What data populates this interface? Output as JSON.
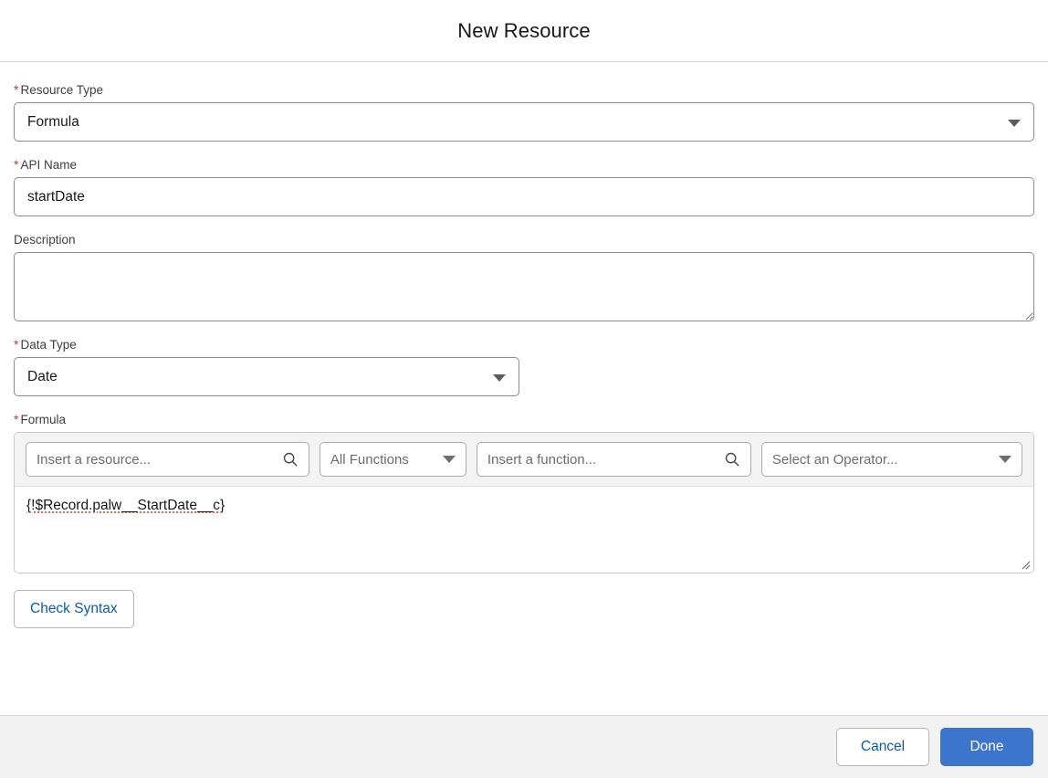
{
  "header": {
    "title": "New Resource"
  },
  "form": {
    "resource_type": {
      "label": "Resource Type",
      "required_marker": "*",
      "value": "Formula"
    },
    "api_name": {
      "label": "API Name",
      "required_marker": "*",
      "value": "startDate",
      "placeholder": ""
    },
    "description": {
      "label": "Description",
      "value": "",
      "placeholder": ""
    },
    "data_type": {
      "label": "Data Type",
      "required_marker": "*",
      "value": "Date"
    },
    "formula": {
      "label": "Formula",
      "required_marker": "*",
      "toolbar": {
        "insert_resource_placeholder": "Insert a resource...",
        "functions_filter_value": "All Functions",
        "insert_function_placeholder": "Insert a function...",
        "operator_placeholder": "Select an Operator...",
        "resource_search_icon": "search-icon",
        "function_search_icon": "search-icon",
        "functions_caret_icon": "chevron-down-icon",
        "operator_caret_icon": "chevron-down-icon"
      },
      "expression": "{!$Record.palw__StartDate__c}"
    },
    "check_syntax_label": "Check Syntax"
  },
  "footer": {
    "cancel_label": "Cancel",
    "done_label": "Done"
  },
  "colors": {
    "brand_blue": "#3b76cc",
    "link_blue": "#0b5cab",
    "required_red": "#c23934",
    "footer_bg": "#f3f2f2",
    "toolbar_bg": "#f3f3f3",
    "border_gray": "#8c8c8c",
    "spellcheck_red": "#e8695b"
  }
}
